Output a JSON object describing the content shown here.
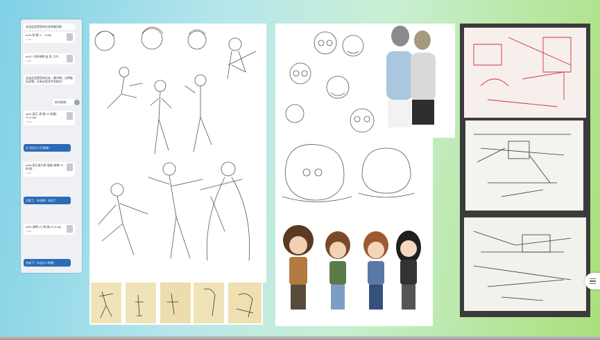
{
  "chat": {
    "messages": [
      {
        "text": "宝宝这里是您的任务审查回顾",
        "kind": "text"
      },
      {
        "text": "sc14-桥\n影-1-…3.clip",
        "kind": "file",
        "meta": "1.1KB"
      },
      {
        "text": "sc42-人物/海绵-益\n兆-二外…",
        "kind": "file",
        "meta": "1.1KB"
      },
      {
        "text": "宝宝这里是您的任务，重中期，记得能告诉哦，还有这里文件夹格式！",
        "kind": "text"
      },
      {
        "text": "好的收到!",
        "kind": "reply"
      },
      {
        "text": "sc42-国王-表\n情-V1-构图-V1.0.clip",
        "kind": "file",
        "meta": "1.1KB"
      },
      {
        "text": "太 辛苦大人们啦着！",
        "kind": "bar"
      },
      {
        "text": "sc59-国王被大家\n鼓励-海绵-V1-构\n图…",
        "kind": "file",
        "meta": "1.1KB"
      },
      {
        "text": "大家了，辛苦啦！辛苦了",
        "kind": "bar"
      },
      {
        "text": "sc50-海绵-V1-构\n图-V1.0.clip",
        "kind": "file",
        "meta": "1.1KB"
      },
      {
        "text": "完成了！辛苦大人啦着！",
        "kind": "bar"
      }
    ]
  },
  "colors": {
    "chat_bar": "#2c6bb5",
    "sketch_red": "#c8353e",
    "notebook_bg": "#3b3b3b"
  },
  "icons": {
    "file": "file-icon",
    "avatar": "avatar-icon",
    "scroll_menu": "menu-icon"
  }
}
